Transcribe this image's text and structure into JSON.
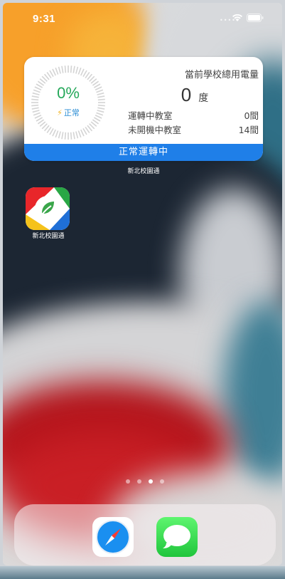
{
  "status_bar": {
    "time": "9:31"
  },
  "widget": {
    "percent": "0%",
    "status_label": "正常",
    "title": "當前學校總用電量",
    "usage_value": "0",
    "usage_unit": "度",
    "rows": [
      {
        "label": "運轉中教室",
        "value": "0間"
      },
      {
        "label": "未開機中教室",
        "value": "14間"
      }
    ],
    "footer": "正常運轉中",
    "app_name": "新北校園通",
    "colors": {
      "percent": "#25a85a",
      "status": "#2a8dd4",
      "footer_bg": "#1f7fe8",
      "bolt": "#f2b21e"
    }
  },
  "home": {
    "apps": [
      {
        "name": "新北校園通",
        "icon": "leaf-app-icon"
      }
    ],
    "page_dots": {
      "count": 4,
      "active": 3
    }
  },
  "dock": {
    "apps": [
      {
        "icon": "safari-icon"
      },
      {
        "icon": "messages-icon"
      }
    ]
  }
}
